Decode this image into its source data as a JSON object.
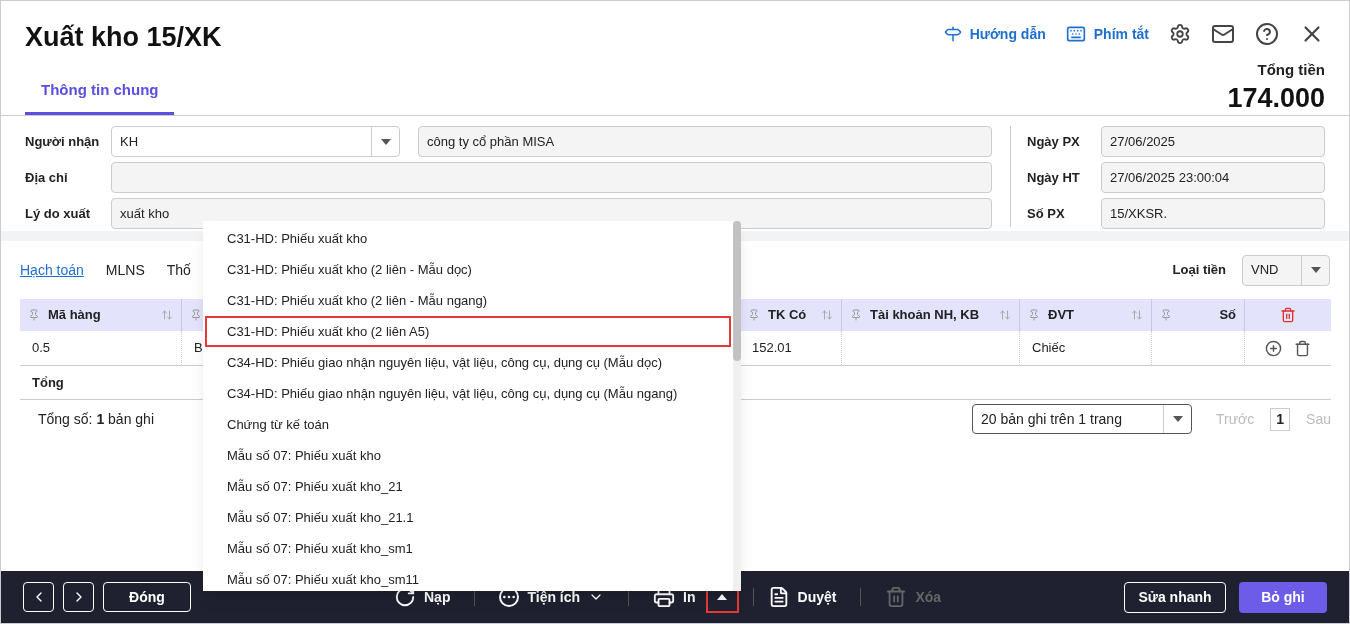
{
  "window": {
    "title": "Xuất kho 15/XK"
  },
  "header_links": [
    {
      "kind": "guide",
      "label": "Hướng dẫn"
    },
    {
      "kind": "shortcuts",
      "label": "Phím tắt"
    }
  ],
  "total": {
    "label": "Tổng tiền",
    "value": "174.000"
  },
  "tabs": [
    {
      "label": "Thông tin chung",
      "selected": true
    }
  ],
  "form_left": [
    {
      "label": "Người nhận",
      "kind": "combo",
      "value": "KH",
      "extra": "công ty cổ phần MISA"
    },
    {
      "label": "Địa chỉ",
      "kind": "text"
    },
    {
      "label": "Lý do xuất",
      "kind": "text",
      "value": "xuất kho"
    }
  ],
  "form_right": [
    {
      "label": "Ngày PX",
      "value": "27/06/2025"
    },
    {
      "label": "Ngày HT",
      "value": "27/06/2025 23:00:04"
    },
    {
      "label": "Số PX",
      "value": "15/XKSR."
    }
  ],
  "detail_tabs": [
    {
      "label": "Hạch toán",
      "selected": true
    },
    {
      "label": "MLNS",
      "selected": false
    },
    {
      "label": "Thố",
      "selected": false
    }
  ],
  "currency": {
    "label": "Loại tiền",
    "value": "VND"
  },
  "table": {
    "columns": [
      {
        "label": "Mã hàng",
        "sortable": true
      },
      {},
      {
        "label": "TK Có",
        "sortable": true
      },
      {
        "label": "Tài khoản NH, KB",
        "sortable": true
      },
      {
        "label": "ĐVT",
        "sortable": true
      },
      {
        "label": "Số",
        "sortable": false
      }
    ],
    "rows": [
      [
        {
          "text": "0.5"
        },
        {
          "text": "B"
        },
        {
          "text": "152.01"
        },
        {},
        {
          "text": "Chiếc"
        },
        {}
      ]
    ],
    "total_label": "Tổng"
  },
  "pager": {
    "summary": "Tổng số: **1** bản ghi",
    "page_size": "20 bản ghi trên 1 trang",
    "prev": "Trước",
    "page": "1",
    "next": "Sau"
  },
  "print_menu": [
    {
      "label": "C31-HD: Phiếu xuất kho",
      "selected": false
    },
    {
      "label": "C31-HD: Phiếu xuất kho (2 liên - Mẫu dọc)",
      "selected": false
    },
    {
      "label": "C31-HD: Phiếu xuất kho (2 liên - Mẫu ngang)",
      "selected": false
    },
    {
      "label": "C31-HD: Phiếu xuất kho (2 liên A5)",
      "selected": true
    },
    {
      "label": "C34-HD: Phiếu giao nhận nguyên liệu, vật liệu, công cụ, dụng cụ (Mẫu dọc)",
      "selected": false
    },
    {
      "label": "C34-HD: Phiếu giao nhận nguyên liệu, vật liệu, công cụ, dụng cụ (Mẫu ngang)",
      "selected": false
    },
    {
      "label": "Chứng từ kế toán",
      "selected": false
    },
    {
      "label": "Mẫu số 07: Phiếu xuất kho",
      "selected": false
    },
    {
      "label": "Mẫu số 07: Phiếu xuất kho_21",
      "selected": false
    },
    {
      "label": "Mẫu số 07: Phiếu xuất kho_21.1",
      "selected": false
    },
    {
      "label": "Mẫu số 07: Phiếu xuất kho_sm1",
      "selected": false
    },
    {
      "label": "Mẫu số 07: Phiếu xuất kho_sm11",
      "selected": false
    }
  ],
  "footer": {
    "close": "Đóng",
    "reload": "Nạp",
    "utilities": "Tiện ích",
    "print": "In",
    "print_menu_open": true,
    "approve": "Duyệt",
    "delete": "Xóa",
    "delete_disabled": true,
    "quick_edit": "Sửa nhanh",
    "discard": "Bỏ ghi"
  }
}
